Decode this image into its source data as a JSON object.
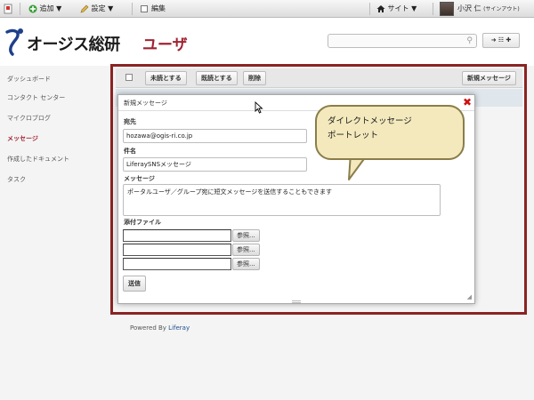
{
  "dock": {
    "add_label": "追加 ▼",
    "settings_label": "設定 ▼",
    "edit_label": "編集",
    "site_label": "サイト ▼",
    "user_name": "小沢 仁",
    "signout_label": "(サインアウト)"
  },
  "header": {
    "logo_text": "オージス総研",
    "page_title": "ユーザ",
    "search_placeholder": "",
    "search_button_label": "➜ ☷ ✚"
  },
  "sidebar": {
    "items": [
      {
        "label": "ダッシュボード"
      },
      {
        "label": "コンタクト センター"
      },
      {
        "label": "マイクロブログ"
      },
      {
        "label": "メッセージ"
      },
      {
        "label": "作成したドキュメント"
      },
      {
        "label": "タスク"
      }
    ],
    "active_index": 3
  },
  "toolbar": {
    "mark_unread": "未読とする",
    "mark_read": "既読とする",
    "delete": "削除",
    "new_message": "新規メッセージ"
  },
  "dialog": {
    "title": "新規メッセージ",
    "to_label": "宛先",
    "to_value": "hozawa@ogis-ri.co.jp",
    "subject_label": "件名",
    "subject_value": "LiferaySNSメッセージ",
    "message_label": "メッセージ",
    "message_value": "ポータルユーザ／グループ宛に短文メッセージを送信することもできます",
    "attachments_label": "添付ファイル",
    "browse_label": "参照...",
    "send_label": "送信"
  },
  "callout": {
    "line1": "ダイレクトメッセージ",
    "line2": "ポートレット"
  },
  "footer": {
    "powered_by": "Powered By",
    "powered_link": "Liferay"
  },
  "colors": {
    "accent": "#a02333",
    "frame": "#8b2323",
    "callout_fill": "#f3e9bd",
    "link": "#1c4e8c"
  }
}
